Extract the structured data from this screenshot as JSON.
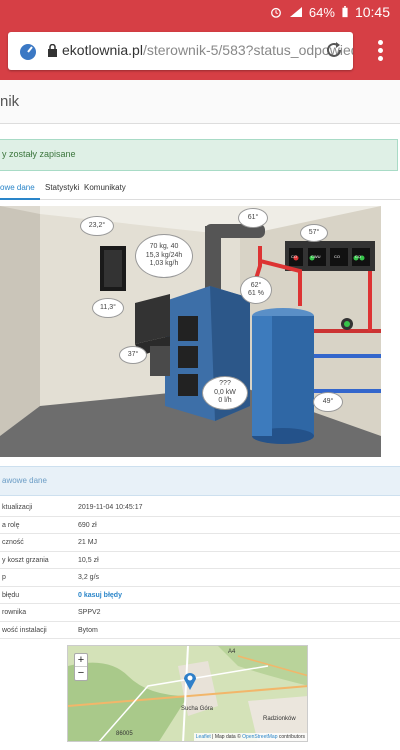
{
  "status_bar": {
    "battery": "64%",
    "time": "10:45"
  },
  "browser": {
    "url_domain": "ekotlownia.pl",
    "url_path": "/sterownik-5/583?status_odpowied"
  },
  "page": {
    "title": "nik",
    "alert": "y zostały zapisane",
    "tabs": [
      {
        "label": "owe dane",
        "active": true
      },
      {
        "label": "Statystyki",
        "active": false
      },
      {
        "label": "Komunikaty",
        "active": false
      }
    ]
  },
  "scene": {
    "temp_room": "23,2°",
    "temp_outside": "11,3°",
    "fuel_info": [
      "70 kg, 40",
      "15,3 kg/24h",
      "1,03 kg/h"
    ],
    "boiler_top": "61°",
    "boiler_mid": [
      "62°",
      "61 %"
    ],
    "feeder_temp": "37°",
    "power_info": [
      "???",
      "0,0 kW",
      "0 l/h"
    ],
    "tank_temp": "49°",
    "pump_panel": "57°",
    "controls": [
      "CO",
      "CWU",
      "CO",
      "CO"
    ]
  },
  "details": {
    "section_title": "awowe dane",
    "rows": [
      {
        "key": "ktualizacji",
        "value": "2019-11-04 10:45:17",
        "link": false
      },
      {
        "key": "a rolę",
        "value": "690 zł",
        "link": false
      },
      {
        "key": "czność",
        "value": "21 MJ",
        "link": false
      },
      {
        "key": "y koszt grzania",
        "value": "10,5 zł",
        "link": false
      },
      {
        "key": "p",
        "value": "3,2 g/s",
        "link": false
      },
      {
        "key": "błędu",
        "value": "0 kasuj błędy",
        "link": true
      },
      {
        "key": "rownika",
        "value": "SPPV2",
        "link": false
      },
      {
        "key": "wość instalacji",
        "value": "Bytom",
        "link": false
      }
    ]
  },
  "map": {
    "zoom_in": "+",
    "zoom_out": "−",
    "labels": [
      "Sucha Góra",
      "Radzionków",
      "86005",
      "A4"
    ],
    "attrib_leaflet": "Leaflet",
    "attrib_text": " | Map data © ",
    "attrib_osm": "OpenStreetMap",
    "attrib_tail": " contributors"
  },
  "colors": {
    "brand_red": "#d63f45",
    "link_blue": "#2a85c9",
    "success_bg": "#dff0e6"
  }
}
